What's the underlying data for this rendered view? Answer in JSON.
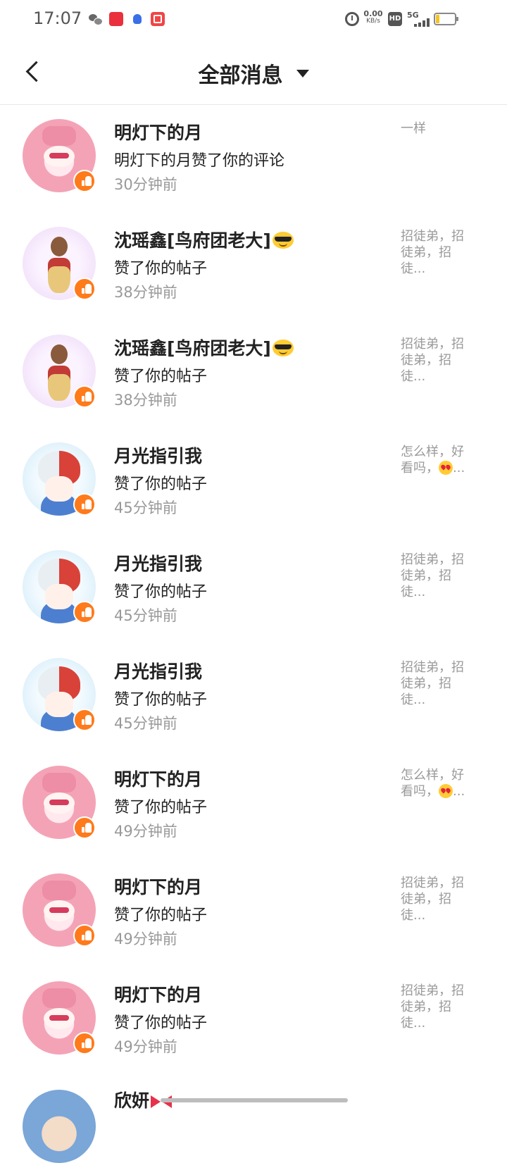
{
  "status_bar": {
    "time": "17:07",
    "app_icons": [
      "wechat-icon",
      "xiaohongshu-icon",
      "baidu-icon",
      "video-app-icon"
    ],
    "alarm_icon": "alarm-icon",
    "net_speed": "0.00",
    "net_speed_unit": "KB/s",
    "hd_label": "HD",
    "network_label": "5G",
    "battery_color": "#f5c323"
  },
  "header": {
    "back_icon": "back-arrow-icon",
    "title": "全部消息",
    "dropdown_icon": "triangle-down-icon"
  },
  "accent_color": "#ff7a1a",
  "messages": [
    {
      "name": "明灯下的月",
      "name_emoji": "",
      "action": "明灯下的月赞了你的评论",
      "time": "30分钟前",
      "preview": "一样",
      "preview_emoji": "",
      "avatar": "pink-anime-avatar"
    },
    {
      "name": "沈瑶鑫[鸟府团老大]",
      "name_emoji": "sunglasses-emoji",
      "action": "赞了你的帖子",
      "time": "38分钟前",
      "preview": "招徒弟，招徒弟，招徒...",
      "preview_emoji": "",
      "avatar": "doll-avatar"
    },
    {
      "name": "沈瑶鑫[鸟府团老大]",
      "name_emoji": "sunglasses-emoji",
      "action": "赞了你的帖子",
      "time": "38分钟前",
      "preview": "招徒弟，招徒弟，招徒...",
      "preview_emoji": "",
      "avatar": "doll-avatar"
    },
    {
      "name": "月光指引我",
      "name_emoji": "",
      "action": "赞了你的帖子",
      "time": "45分钟前",
      "preview": "怎么样，好看吗，",
      "preview_emoji": "heart-eyes-emoji",
      "preview_suffix": "...",
      "avatar": "anime-boy-avatar"
    },
    {
      "name": "月光指引我",
      "name_emoji": "",
      "action": "赞了你的帖子",
      "time": "45分钟前",
      "preview": "招徒弟，招徒弟，招徒...",
      "preview_emoji": "",
      "avatar": "anime-boy-avatar"
    },
    {
      "name": "月光指引我",
      "name_emoji": "",
      "action": "赞了你的帖子",
      "time": "45分钟前",
      "preview": "招徒弟，招徒弟，招徒...",
      "preview_emoji": "",
      "avatar": "anime-boy-avatar"
    },
    {
      "name": "明灯下的月",
      "name_emoji": "",
      "action": "赞了你的帖子",
      "time": "49分钟前",
      "preview": "怎么样，好看吗，",
      "preview_emoji": "heart-eyes-emoji",
      "preview_suffix": "...",
      "avatar": "pink-anime-avatar"
    },
    {
      "name": "明灯下的月",
      "name_emoji": "",
      "action": "赞了你的帖子",
      "time": "49分钟前",
      "preview": "招徒弟，招徒弟，招徒...",
      "preview_emoji": "",
      "avatar": "pink-anime-avatar"
    },
    {
      "name": "明灯下的月",
      "name_emoji": "",
      "action": "赞了你的帖子",
      "time": "49分钟前",
      "preview": "招徒弟，招徒弟，招徒...",
      "preview_emoji": "",
      "avatar": "pink-anime-avatar"
    }
  ],
  "partial_item": {
    "name": "欣妍",
    "name_emoji": "bow-emoji",
    "avatar": "girl-avatar"
  }
}
